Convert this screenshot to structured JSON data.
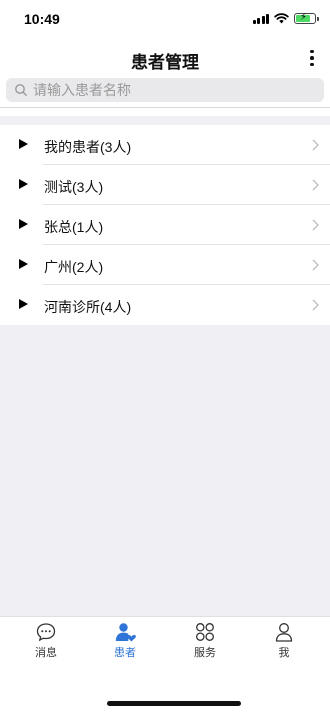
{
  "status_bar": {
    "time": "10:49"
  },
  "nav": {
    "title": "患者管理"
  },
  "search": {
    "placeholder": "请输入患者名称"
  },
  "groups": [
    {
      "label": "我的患者(3人)"
    },
    {
      "label": "测试(3人)"
    },
    {
      "label": "张总(1人)"
    },
    {
      "label": "广州(2人)"
    },
    {
      "label": "河南诊所(4人)"
    }
  ],
  "tabs": [
    {
      "label": "消息",
      "icon": "chat-bubble-icon"
    },
    {
      "label": "患者",
      "icon": "patient-icon",
      "active": true
    },
    {
      "label": "服务",
      "icon": "services-grid-icon"
    },
    {
      "label": "我",
      "icon": "profile-icon"
    }
  ],
  "colors": {
    "accent": "#2f74d6",
    "background": "#efeff4",
    "battery": "#4cd964"
  }
}
